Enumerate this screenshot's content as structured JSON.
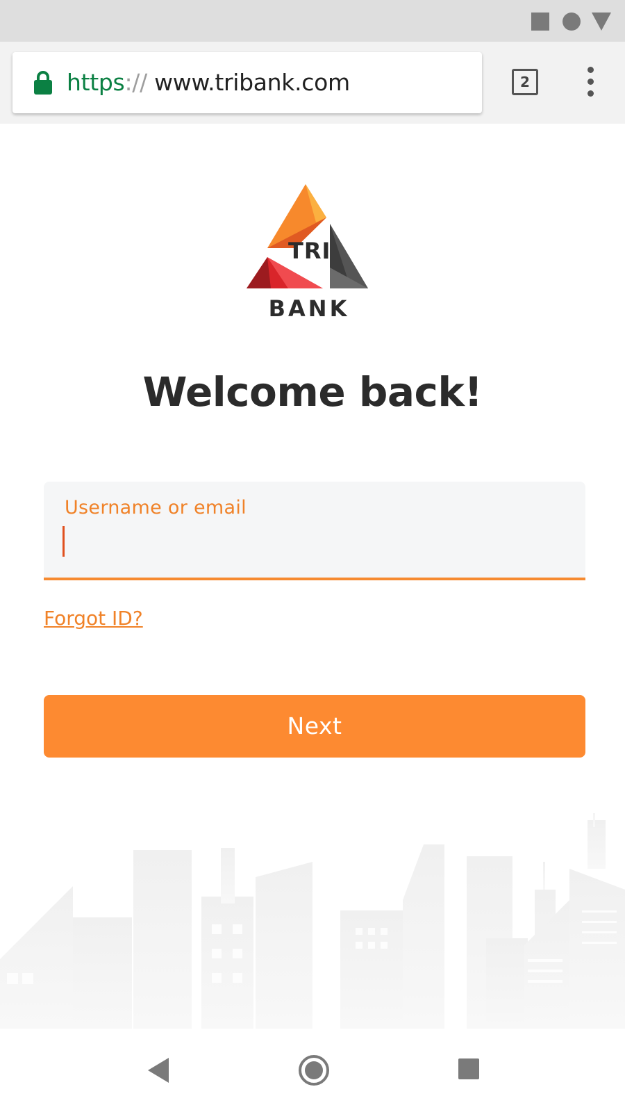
{
  "browser": {
    "url_scheme": "https",
    "url_separator": "://",
    "url_host": "www.tribank.com",
    "tab_count": "2",
    "secure_color": "#0b8043"
  },
  "logo": {
    "top_word": "TRI",
    "bottom_word": "BANK"
  },
  "login": {
    "heading": "Welcome back!",
    "username_label": "Username or email",
    "username_value": "",
    "forgot_link": "Forgot ID?",
    "next_button": "Next"
  },
  "colors": {
    "accent": "#fd8a31",
    "heading": "#2b2b2b"
  },
  "icons": {
    "status_bar": [
      "square-icon",
      "circle-icon",
      "triangle-icon"
    ],
    "toolbar": [
      "lock-icon",
      "tab-switcher-icon",
      "more-vert-icon"
    ],
    "nav_bar": [
      "back-icon",
      "home-icon",
      "recents-icon"
    ]
  }
}
